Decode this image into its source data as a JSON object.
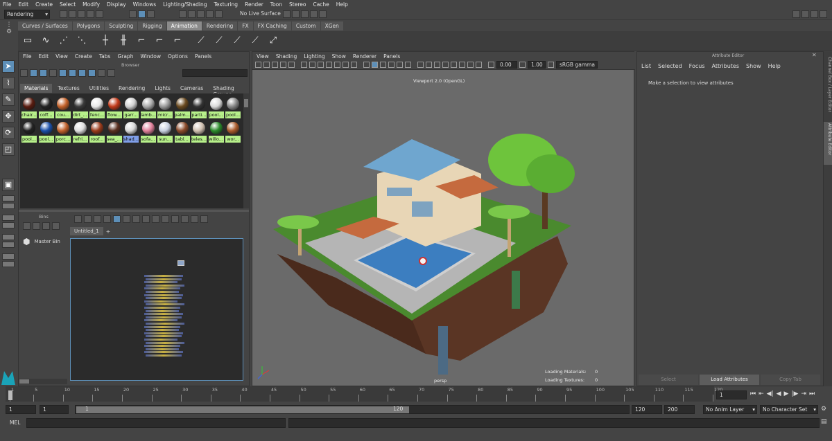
{
  "menubar": [
    "File",
    "Edit",
    "Create",
    "Select",
    "Modify",
    "Display",
    "Windows",
    "Lighting/Shading",
    "Texturing",
    "Render",
    "Toon",
    "Stereo",
    "Cache",
    "Help"
  ],
  "status": {
    "menu_set": "Rendering",
    "live_surface": "No Live Surface"
  },
  "shelf_tabs": [
    "Curves / Surfaces",
    "Polygons",
    "Sculpting",
    "Rigging",
    "Animation",
    "Rendering",
    "FX",
    "FX Caching",
    "Custom",
    "XGen"
  ],
  "shelf_active": "Animation",
  "hypershade": {
    "menu": [
      "File",
      "Edit",
      "View",
      "Create",
      "Tabs",
      "Graph",
      "Window",
      "Options",
      "Panels"
    ],
    "browser_title": "Browser",
    "tabs": [
      "Materials",
      "Textures",
      "Utilities",
      "Rendering",
      "Lights",
      "Cameras",
      "Shading Groups"
    ],
    "materials_row1": [
      "chair...",
      "coff...",
      "cou...",
      "dirt_...",
      "fenc...",
      "flow...",
      "garr...",
      "lamb...",
      "micr...",
      "palm...",
      "parti...",
      "pool...",
      "pool..."
    ],
    "materials_row2": [
      "pool...",
      "pool...",
      "porc...",
      "refri...",
      "roof...",
      "sea_...",
      "shad...",
      "sofa...",
      "sun...",
      "tabl...",
      "teles...",
      "willo...",
      "wor..."
    ],
    "bins_title": "Bins",
    "master_bin": "Master Bin",
    "graph_tab": "Untitled_1",
    "graph_tab_add": "+"
  },
  "viewport": {
    "menu": [
      "View",
      "Shading",
      "Lighting",
      "Show",
      "Renderer",
      "Panels"
    ],
    "exposure": "0.00",
    "gamma": "1.00",
    "colorspace": "sRGB gamma",
    "title": "Viewport 2.0 (OpenGL)",
    "camera": "persp",
    "loading_materials_label": "Loading Materials:",
    "loading_materials": "0",
    "loading_textures_label": "Loading Textures:",
    "loading_textures": "0"
  },
  "attribute_editor": {
    "title": "Attribute Editor",
    "menu": [
      "List",
      "Selected",
      "Focus",
      "Attributes",
      "Show",
      "Help"
    ],
    "message": "Make a selection to view attributes",
    "buttons": [
      "Select",
      "Load Attributes",
      "Copy Tab"
    ],
    "side_tabs": [
      "Channel Box / Layer Editor",
      "Attribute Editor"
    ]
  },
  "timeline": {
    "ticks": [
      "1",
      "5",
      "10",
      "15",
      "20",
      "25",
      "30",
      "35",
      "40",
      "45",
      "50",
      "55",
      "60",
      "65",
      "70",
      "75",
      "80",
      "85",
      "90",
      "95",
      "100",
      "105",
      "110",
      "115",
      "120"
    ],
    "current_frame": "1",
    "range_start": "1",
    "range_inner_start": "1",
    "slider_start": "1",
    "slider_end": "120",
    "range_inner_end": "120",
    "range_end": "200",
    "anim_layer": "No Anim Layer",
    "char_set": "No Character Set",
    "cmd_label": "MEL"
  }
}
